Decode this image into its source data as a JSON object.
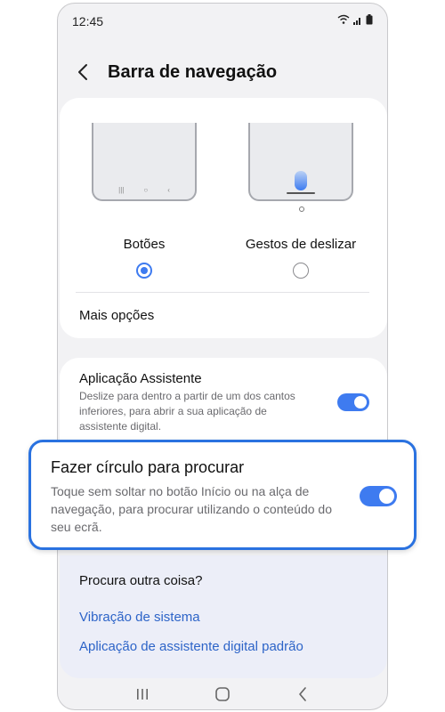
{
  "status": {
    "time": "12:45"
  },
  "header": {
    "title": "Barra de navegação"
  },
  "navigation_type": {
    "options": [
      {
        "label": "Botões",
        "selected": true
      },
      {
        "label": "Gestos de deslizar",
        "selected": false
      }
    ],
    "more_options": "Mais opções"
  },
  "assistant_app": {
    "title": "Aplicação Assistente",
    "description": "Deslize para dentro a partir de um dos cantos inferiores, para abrir a sua aplicação de assistente digital.",
    "enabled": true
  },
  "circle_to_search": {
    "title": "Fazer círculo para procurar",
    "description": "Toque sem soltar no botão Início ou na alça de navegação, para procurar utilizando o conteúdo do seu ecrã.",
    "enabled": true
  },
  "looking_for_something_else": {
    "title": "Procura outra coisa?",
    "links": [
      "Vibração de sistema",
      "Aplicação de assistente digital padrão"
    ]
  },
  "icons": {
    "back": "chevron-left-icon",
    "recents": "recents-icon",
    "home": "home-icon",
    "nav_back": "back-icon"
  },
  "colors": {
    "accent": "#3e7bf0",
    "highlight_border": "#2a72e0",
    "link": "#2d64c8"
  }
}
